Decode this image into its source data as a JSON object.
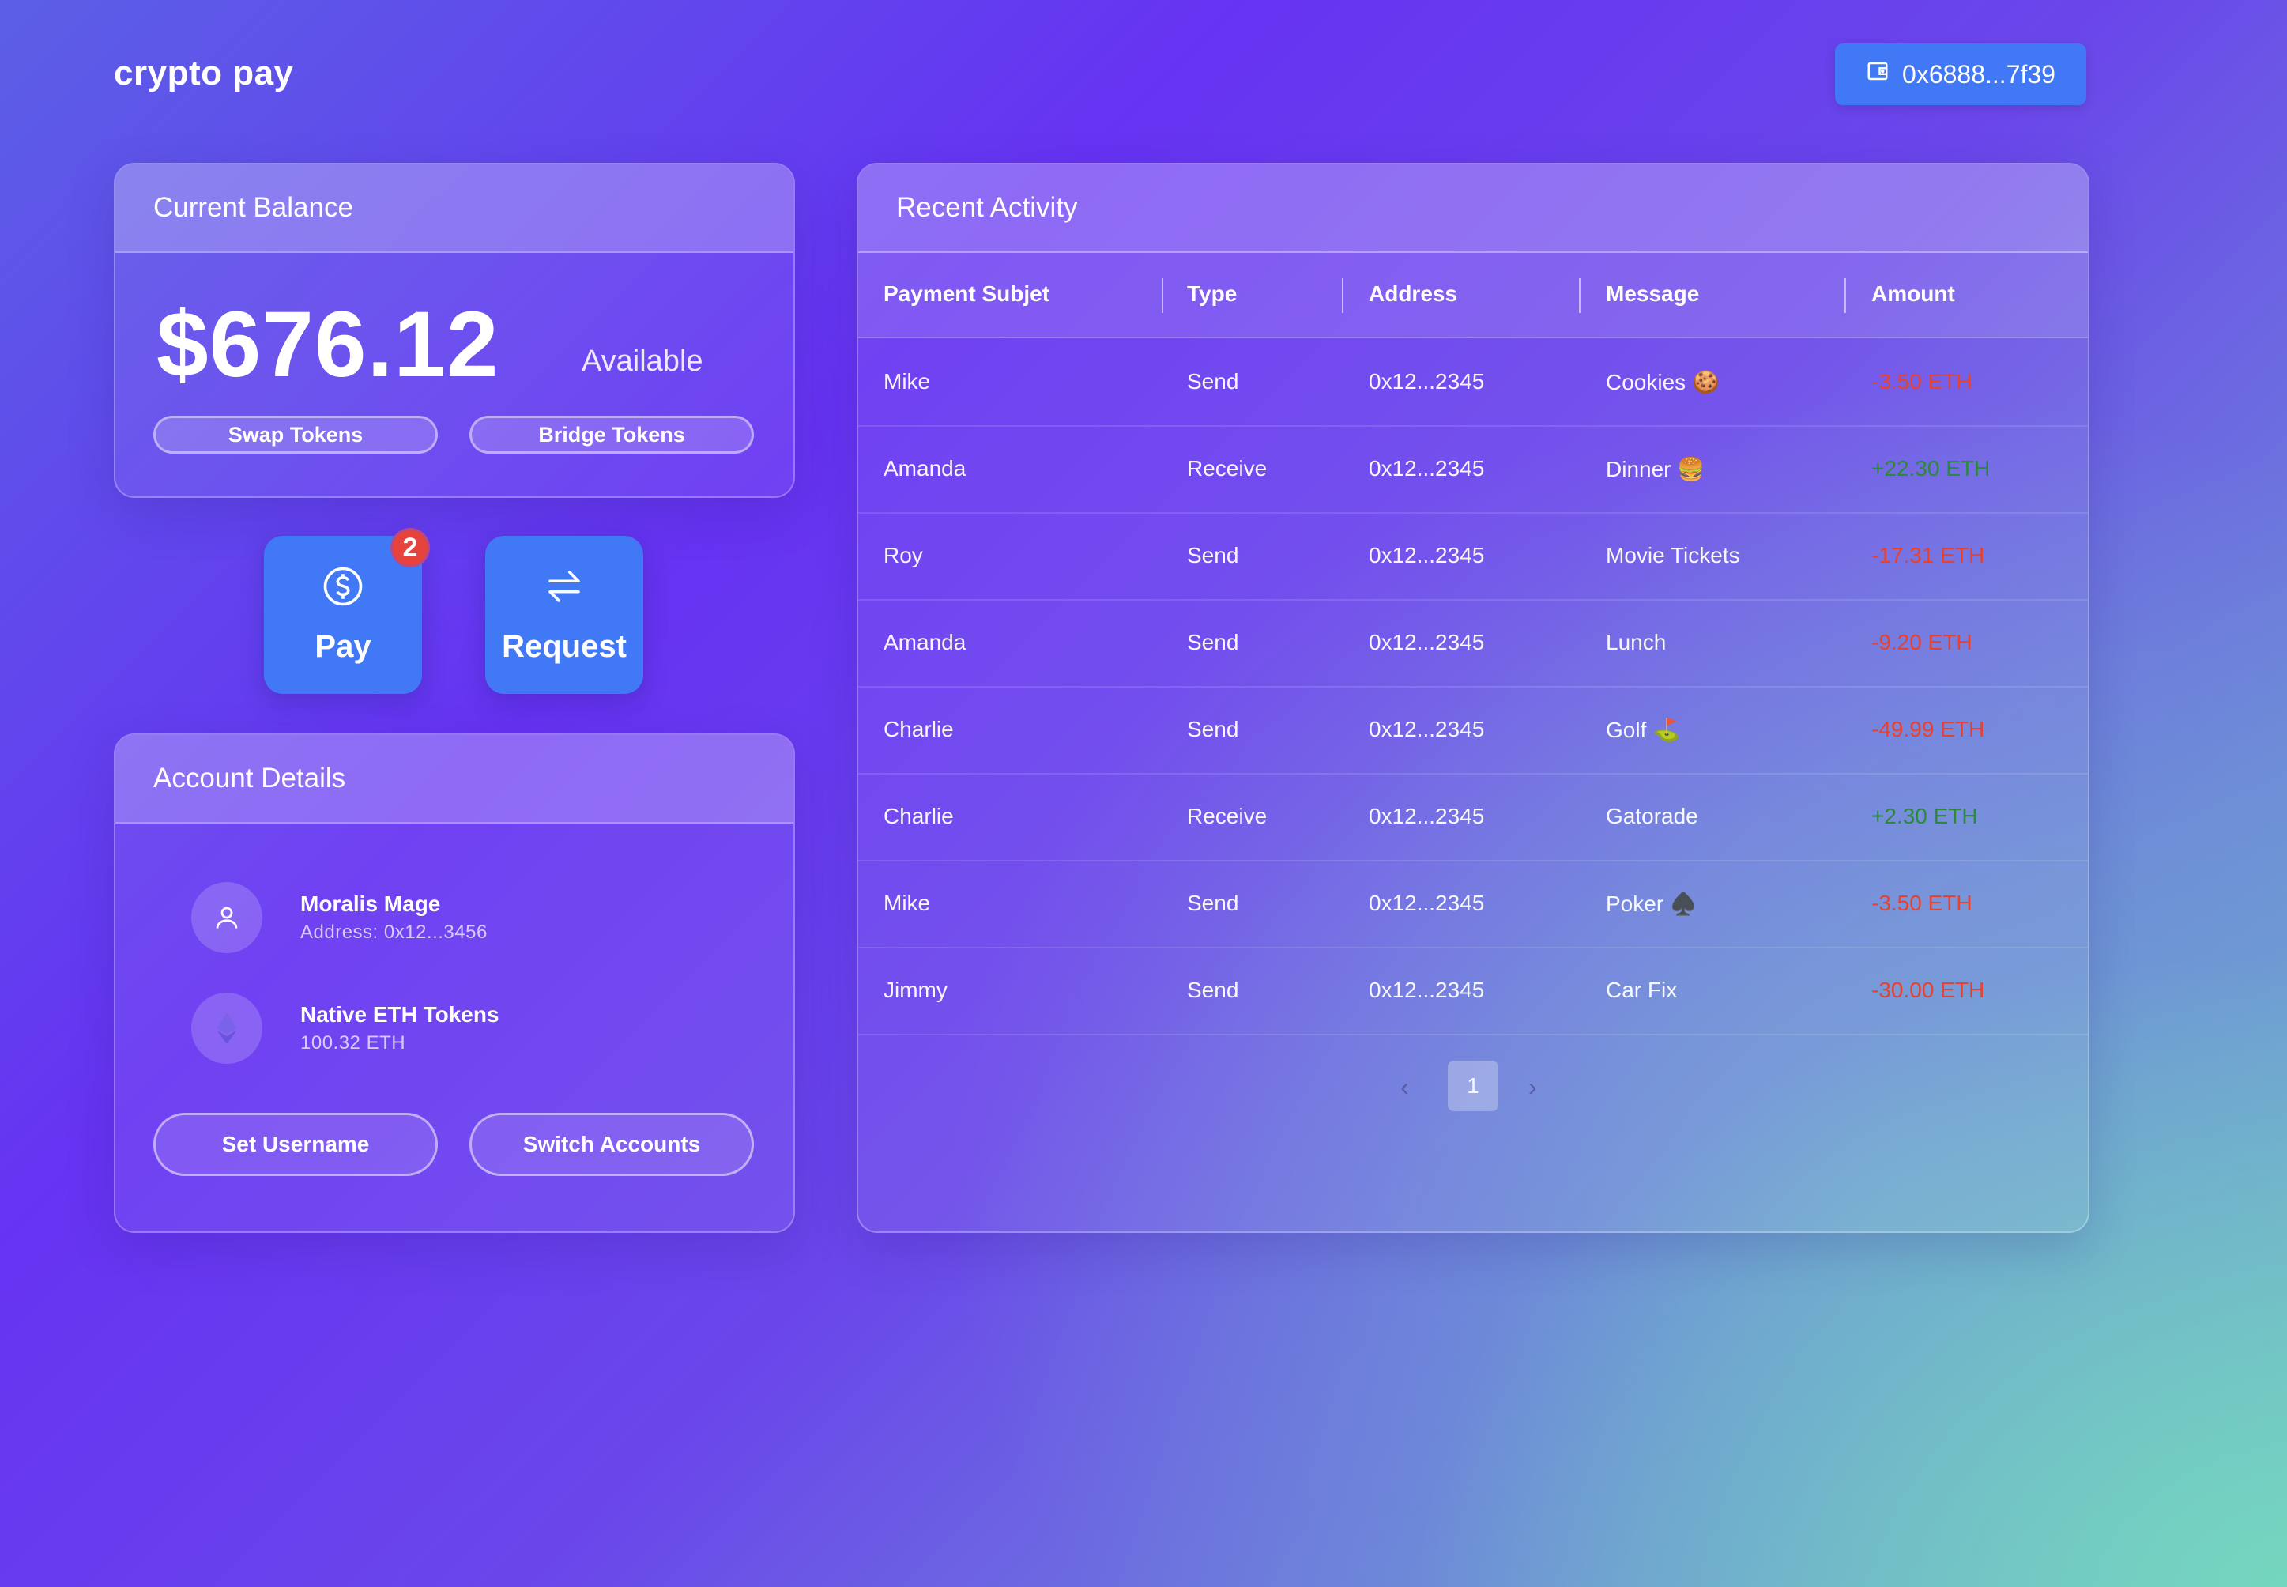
{
  "app": {
    "title": "crypto pay"
  },
  "wallet": {
    "address": "0x6888...7f39",
    "icon": "wallet-icon"
  },
  "balance": {
    "heading": "Current Balance",
    "amount": "$676.12",
    "available_label": "Available",
    "swap_label": "Swap Tokens",
    "bridge_label": "Bridge Tokens"
  },
  "actions": {
    "pay_label": "Pay",
    "pay_badge": "2",
    "request_label": "Request",
    "pay_icon": "dollar-circle-icon",
    "request_icon": "swap-arrows-icon"
  },
  "account": {
    "heading": "Account Details",
    "user_name": "Moralis Mage",
    "user_address": "Address: 0x12...3456",
    "token_title": "Native ETH Tokens",
    "token_amount": "100.32 ETH",
    "set_username_label": "Set Username",
    "switch_accounts_label": "Switch Accounts"
  },
  "activity": {
    "heading": "Recent Activity",
    "columns": [
      "Payment Subjet",
      "Type",
      "Address",
      "Message",
      "Amount"
    ],
    "rows": [
      {
        "subject": "Mike",
        "type": "Send",
        "address": "0x12...2345",
        "message": "Cookies 🍪",
        "amount": "-3.50 ETH",
        "sign": "neg"
      },
      {
        "subject": "Amanda",
        "type": "Receive",
        "address": "0x12...2345",
        "message": "Dinner 🍔",
        "amount": "+22.30 ETH",
        "sign": "pos"
      },
      {
        "subject": "Roy",
        "type": "Send",
        "address": "0x12...2345",
        "message": "Movie Tickets",
        "amount": "-17.31 ETH",
        "sign": "neg"
      },
      {
        "subject": "Amanda",
        "type": "Send",
        "address": "0x12...2345",
        "message": "Lunch",
        "amount": "-9.20 ETH",
        "sign": "neg"
      },
      {
        "subject": "Charlie",
        "type": "Send",
        "address": "0x12...2345",
        "message": "Golf ⛳",
        "amount": "-49.99 ETH",
        "sign": "neg"
      },
      {
        "subject": "Charlie",
        "type": "Receive",
        "address": "0x12...2345",
        "message": "Gatorade",
        "amount": "+2.30 ETH",
        "sign": "pos"
      },
      {
        "subject": "Mike",
        "type": "Send",
        "address": "0x12...2345",
        "message": "Poker ♠️",
        "amount": "-3.50 ETH",
        "sign": "neg"
      },
      {
        "subject": "Jimmy",
        "type": "Send",
        "address": "0x12...2345",
        "message": "Car Fix",
        "amount": "-30.00 ETH",
        "sign": "neg"
      }
    ],
    "pagination": {
      "current_page": "1",
      "prev": "‹",
      "next": "›"
    }
  },
  "colors": {
    "accent": "#4178f5",
    "negative": "#e8412d",
    "positive": "#2a8a3a",
    "badge": "#e5433c"
  }
}
